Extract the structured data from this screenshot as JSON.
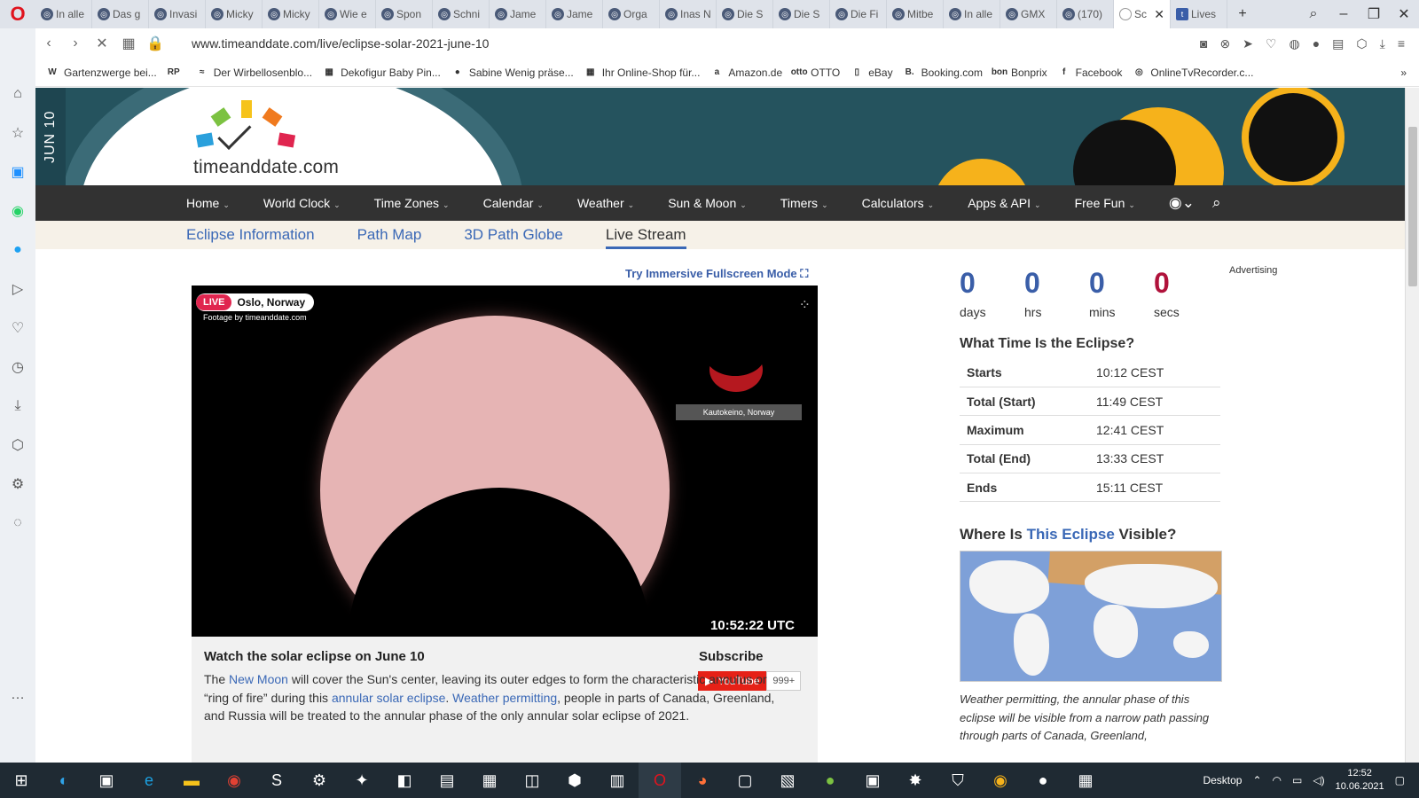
{
  "browser": {
    "tabs": [
      {
        "label": "In alle"
      },
      {
        "label": "Das g"
      },
      {
        "label": "Invasi"
      },
      {
        "label": "Micky"
      },
      {
        "label": "Micky"
      },
      {
        "label": "Wie e"
      },
      {
        "label": "Spon"
      },
      {
        "label": "Schni"
      },
      {
        "label": "Jame"
      },
      {
        "label": "Jame"
      },
      {
        "label": "Orga"
      },
      {
        "label": "Inas N"
      },
      {
        "label": "Die S"
      },
      {
        "label": "Die S"
      },
      {
        "label": "Die Fi"
      },
      {
        "label": "Mitbe"
      },
      {
        "label": "In alle"
      },
      {
        "label": "GMX"
      },
      {
        "label": "(170)"
      }
    ],
    "active_tab": "Sc",
    "last_tab": "Lives",
    "url": "www.timeanddate.com/live/eclipse-solar-2021-june-10",
    "bookmarks": [
      {
        "icon": "W",
        "label": "Gartenzwerge bei..."
      },
      {
        "icon": "RP",
        "label": ""
      },
      {
        "icon": "≈",
        "label": "Der Wirbellosenblo..."
      },
      {
        "icon": "▦",
        "label": "Dekofigur Baby Pin..."
      },
      {
        "icon": "●",
        "label": "Sabine Wenig präse..."
      },
      {
        "icon": "▦",
        "label": "Ihr Online-Shop für..."
      },
      {
        "icon": "a",
        "label": "Amazon.de"
      },
      {
        "icon": "otto",
        "label": "OTTO"
      },
      {
        "icon": "▯",
        "label": "eBay"
      },
      {
        "icon": "B.",
        "label": "Booking.com"
      },
      {
        "icon": "bon",
        "label": "Bonprix"
      },
      {
        "icon": "f",
        "label": "Facebook"
      },
      {
        "icon": "◎",
        "label": "OnlineTvRecorder.c..."
      }
    ]
  },
  "site": {
    "date_tab": "JUN 10",
    "logo_text": "timeanddate.com",
    "nav": [
      "Home",
      "World Clock",
      "Time Zones",
      "Calendar",
      "Weather",
      "Sun & Moon",
      "Timers",
      "Calculators",
      "Apps & API",
      "Free Fun"
    ],
    "subnav": [
      "Eclipse Information",
      "Path Map",
      "3D Path Globe",
      "Live Stream"
    ],
    "fullscreen_link": "Try Immersive Fullscreen Mode"
  },
  "video": {
    "live": "LIVE",
    "location": "Oslo, Norway",
    "footage": "Footage by timeanddate.com",
    "second_cam": "Kautokeino, Norway",
    "time": "10:52:22 UTC"
  },
  "article": {
    "heading": "Watch the solar eclipse on June 10",
    "subscribe": "Subscribe",
    "youtube": "YouTube",
    "subscribers": "999+",
    "p_1": "The ",
    "link_new_moon": "New Moon",
    "p_2": " will cover the Sun's center, leaving its outer edges to form the characteristic annulus or “ring of fire” during this ",
    "link_annular": "annular solar eclipse",
    "p_3": ". ",
    "link_weather": "Weather permitting",
    "p_4": ", people in parts of Canada, Greenland, and Russia will be treated to the annular phase of the only annular solar eclipse of 2021."
  },
  "countdown": {
    "days": "0",
    "days_label": "days",
    "hrs": "0",
    "hrs_label": "hrs",
    "mins": "0",
    "mins_label": "mins",
    "secs": "0",
    "secs_label": "secs"
  },
  "advertising": "Advertising",
  "eclipse_times": {
    "heading": "What Time Is the Eclipse?",
    "rows": [
      {
        "k": "Starts",
        "v": "10:12 CEST"
      },
      {
        "k": "Total (Start)",
        "v": "11:49 CEST"
      },
      {
        "k": "Maximum",
        "v": "12:41 CEST"
      },
      {
        "k": "Total (End)",
        "v": "13:33 CEST"
      },
      {
        "k": "Ends",
        "v": "15:11 CEST"
      }
    ]
  },
  "visibility": {
    "heading_1": "Where Is ",
    "heading_link": "This Eclipse",
    "heading_2": " Visible?",
    "caption": "Weather permitting, the annular phase of this eclipse will be visible from a narrow path passing through parts of Canada, Greenland,"
  },
  "taskbar": {
    "desktop": "Desktop",
    "time": "12:52",
    "date": "10.06.2021"
  }
}
